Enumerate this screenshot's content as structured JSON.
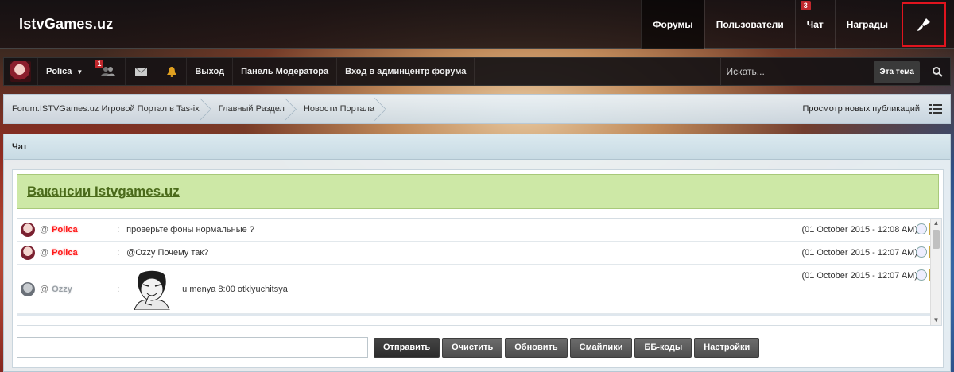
{
  "header": {
    "logo": "IstvGames.uz",
    "nav": [
      {
        "label": "Форумы",
        "active": true
      },
      {
        "label": "Пользователи"
      },
      {
        "label": "Чат",
        "badge": "3"
      },
      {
        "label": "Награды"
      }
    ],
    "style_icon": "paintbrush-icon"
  },
  "userbar": {
    "username": "Polica",
    "friends_badge": "1",
    "logout": "Выход",
    "mod_panel": "Панель Модератора",
    "admin_entry": "Вход в админцентр форума",
    "search_placeholder": "Искать...",
    "search_scope": "Эта тема"
  },
  "breadcrumb": {
    "items": [
      "Forum.ISTVGames.uz Игровой Портал в Tas-ix",
      "Главный Раздел",
      "Новости Портала"
    ],
    "new_posts": "Просмотр новых публикаций"
  },
  "chat": {
    "title": "Чат",
    "announcement": "Вакансии Istvgames.uz",
    "messages": [
      {
        "user": "Polica",
        "text": "проверьте фоны нормальные ?",
        "time": "(01 October 2015 - 12:08 AM)"
      },
      {
        "user": "Polica",
        "text": "@Ozzy Почему так?",
        "time": "(01 October 2015 - 12:07 AM)"
      },
      {
        "user": "Ozzy",
        "text": "u menya 8:00 otklyuchitsya",
        "time": "(01 October 2015 - 12:07 AM)"
      }
    ],
    "buttons": {
      "send": "Отправить",
      "clear": "Очистить",
      "refresh": "Обновить",
      "smileys": "Смайлики",
      "bbcodes": "ББ-коды",
      "settings": "Настройки"
    }
  },
  "colors": {
    "accent_red": "#e0141e",
    "announcement_bg": "#cde8a6",
    "polica_name": "#ff1818"
  }
}
